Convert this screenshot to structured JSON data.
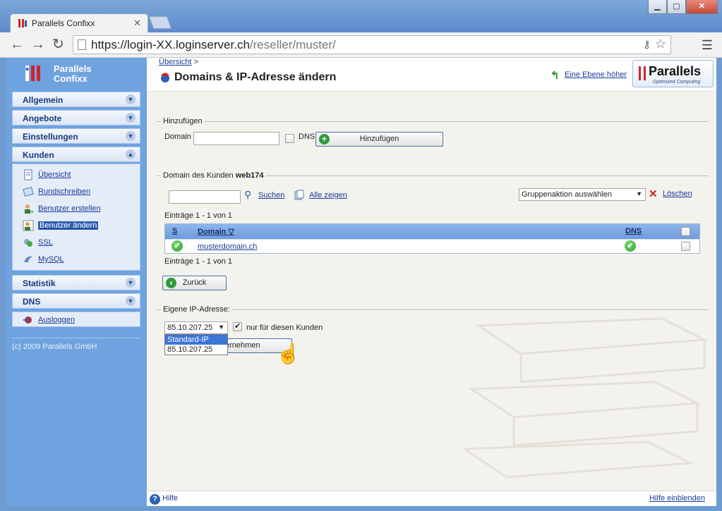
{
  "browser": {
    "tab_title": "Parallels Confixx",
    "url_host": "https://login-XX.loginserver.ch",
    "url_path": "/reseller/muster/"
  },
  "sidebar": {
    "brand_line1": "Parallels",
    "brand_line2": "Confixx",
    "sections": [
      "Allgemein",
      "Angebote",
      "Einstellungen",
      "Kunden"
    ],
    "kunden_items": [
      "Übersicht",
      "Rundschreiben",
      "Benutzer erstellen",
      "Benutzer ändern",
      "SSL",
      "MySQL"
    ],
    "active_item": "Benutzer ändern",
    "sections_after": [
      "Statistik",
      "DNS"
    ],
    "logout": "Ausloggen",
    "copyright": "(c) 2009 Parallels GmbH"
  },
  "header": {
    "breadcrumb_link": "Übersicht",
    "breadcrumb_sep": ">",
    "title": "Domains & IP-Adresse ändern",
    "up_link": "Eine Ebene höher",
    "brand_name": "Parallels",
    "brand_tagline": "Optimized Computing"
  },
  "add_section": {
    "legend": "Hinzufügen",
    "domain_label": "Domain",
    "domain_value": "",
    "dns_label": "DNS",
    "button": "Hinzufügen"
  },
  "domains_section": {
    "legend_prefix": "Domain des Kunden",
    "customer": "web174",
    "search_value": "",
    "search_link": "Suchen",
    "show_all_link": "Alle zeigen",
    "group_action": "Gruppenaktion auswählen",
    "delete_link": "Löschen",
    "entries_top": "Einträge 1 - 1 von 1",
    "entries_bottom": "Einträge 1 - 1 von 1",
    "columns": {
      "status": "S",
      "domain": "Domain",
      "dns": "DNS"
    },
    "rows": [
      {
        "domain": "musterdomain.ch"
      }
    ],
    "back_button": "Zurück"
  },
  "ip_section": {
    "legend": "Eigene IP-Adresse:",
    "selected_ip": "85.10.207.25",
    "only_this_customer_label": "nur für diesen Kunden",
    "options": [
      "Standard-IP",
      "85.10.207.25"
    ],
    "apply_button_partial": "ernehmen"
  },
  "footer": {
    "help": "Hilfe",
    "show_help": "Hilfe einblenden"
  },
  "colors": {
    "sidebar_bg": "#6fa3e0",
    "content_bg": "#f3f2ed",
    "table_header": "#7aa6e0",
    "link": "#1a3a9a",
    "ok_green": "#229a2a"
  }
}
